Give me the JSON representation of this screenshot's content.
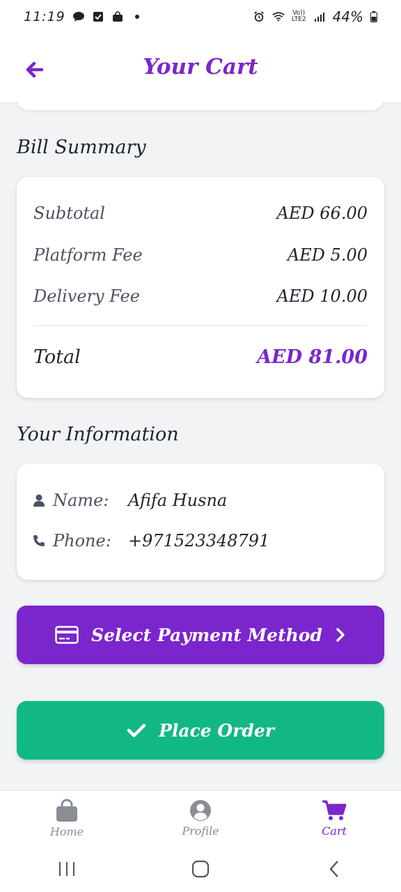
{
  "status_bar": {
    "time": "11:19",
    "battery": "44%",
    "network_top": "Vo))",
    "network_bottom": "LTE2"
  },
  "header": {
    "title": "Your Cart"
  },
  "bill_summary": {
    "title": "Bill Summary",
    "rows": [
      {
        "label": "Subtotal",
        "amount": "AED 66.00"
      },
      {
        "label": "Platform Fee",
        "amount": "AED 5.00"
      },
      {
        "label": "Delivery Fee",
        "amount": "AED 10.00"
      }
    ],
    "total": {
      "label": "Total",
      "amount": "AED 81.00"
    }
  },
  "user_info": {
    "title": "Your Information",
    "name_label": "Name:",
    "name_value": "Afifa Husna",
    "phone_label": "Phone:",
    "phone_value": "+971523348791"
  },
  "buttons": {
    "payment": "Select Payment Method",
    "place_order": "Place Order"
  },
  "bottom_nav": [
    {
      "label": "Home",
      "icon": "shopping-bag-icon"
    },
    {
      "label": "Profile",
      "icon": "user-circle-icon"
    },
    {
      "label": "Cart",
      "icon": "cart-icon",
      "active": true
    }
  ],
  "colors": {
    "accent": "#7b25cc",
    "success": "#12b883",
    "background": "#f2f3f5"
  }
}
